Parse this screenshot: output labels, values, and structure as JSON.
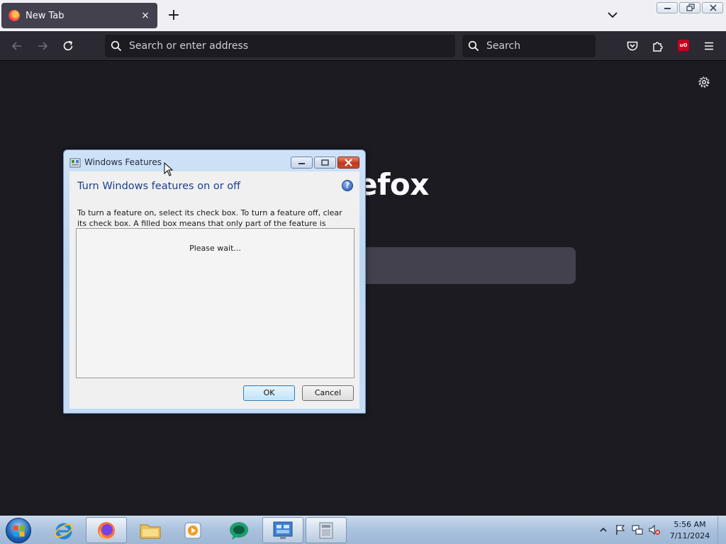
{
  "browser": {
    "tab_title": "New Tab",
    "tab_close": "×",
    "new_tab_symbol": "+",
    "urlbar_placeholder": "Search or enter address",
    "searchbar_placeholder": "Search",
    "ublock_badge": "uO"
  },
  "newtab": {
    "wordmark": "irefox"
  },
  "dialog": {
    "title": "Windows Features",
    "heading": "Turn Windows features on or off",
    "help_symbol": "?",
    "description": "To turn a feature on, select its check box. To turn a feature off, clear its check box. A filled box means that only part of the feature is turned on.",
    "status": "Please wait...",
    "ok_label": "OK",
    "cancel_label": "Cancel"
  },
  "taskbar": {
    "time": "5:56 AM",
    "date": "7/11/2024"
  },
  "colors": {
    "browser_bg": "#1c1b22",
    "toolbar": "#2b2a33",
    "dialog_heading": "#1c3f8f",
    "taskbar": "#a9c1dd"
  }
}
